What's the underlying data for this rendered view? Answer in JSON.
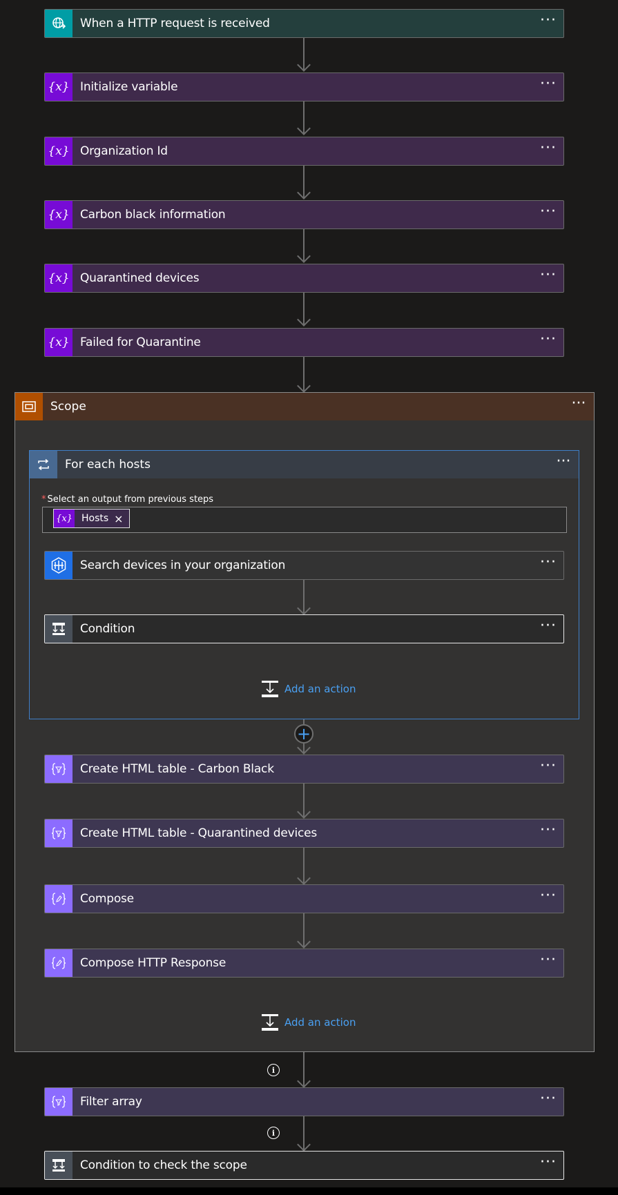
{
  "steps_top": [
    {
      "title": "When a HTTP request is received",
      "kind": "http"
    },
    {
      "title": "Initialize variable",
      "kind": "variable"
    },
    {
      "title": "Organization Id",
      "kind": "variable"
    },
    {
      "title": "Carbon black information",
      "kind": "variable"
    },
    {
      "title": "Quarantined devices",
      "kind": "variable"
    },
    {
      "title": "Failed for Quarantine",
      "kind": "variable"
    }
  ],
  "more_glyph": "···",
  "var_glyph": "{x}",
  "scope": {
    "title": "Scope",
    "add_action_label": "Add an action",
    "for_each": {
      "title": "For each hosts",
      "required_marker": "*",
      "select_label": "Select an output from previous steps",
      "token": {
        "label": "Hosts",
        "remove": "×"
      },
      "steps": [
        {
          "title": "Search devices in your organization",
          "kind": "carbon-black"
        },
        {
          "title": "Condition",
          "kind": "control"
        }
      ],
      "add_action_label": "Add an action"
    },
    "steps": [
      {
        "title": "Create HTML table - Carbon Black",
        "kind": "data"
      },
      {
        "title": "Create HTML table - Quarantined devices",
        "kind": "data"
      },
      {
        "title": "Compose",
        "kind": "data"
      },
      {
        "title": "Compose HTTP Response",
        "kind": "data"
      }
    ]
  },
  "insert_glyph": "+",
  "info_glyph": "i",
  "steps_bottom": [
    {
      "title": "Filter array",
      "kind": "data"
    },
    {
      "title": "Condition to check the scope",
      "kind": "control"
    }
  ],
  "colors": {
    "canvas": "#1b1a19",
    "variable_icon": "#770bd6",
    "http_icon": "#009da5",
    "data_icon": "#8c6cff",
    "scope_icon": "#b04f00",
    "foreach_icon": "#486991",
    "carbon_black_icon": "#1f6fe5",
    "link": "#4aa0f2",
    "foreach_border": "#3f7fc8"
  }
}
